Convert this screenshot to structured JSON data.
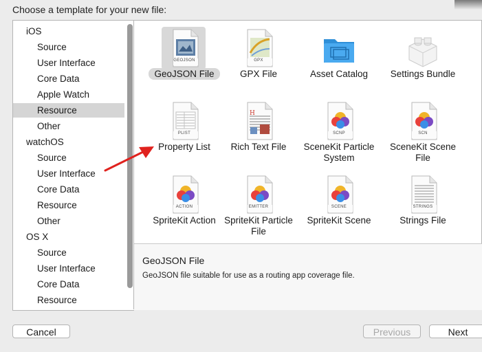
{
  "dialog": {
    "title": "Choose a template for your new file:"
  },
  "sidebar": {
    "items": [
      {
        "label": "iOS",
        "type": "header"
      },
      {
        "label": "Source",
        "type": "sub"
      },
      {
        "label": "User Interface",
        "type": "sub"
      },
      {
        "label": "Core Data",
        "type": "sub"
      },
      {
        "label": "Apple Watch",
        "type": "sub"
      },
      {
        "label": "Resource",
        "type": "sub",
        "selected": true
      },
      {
        "label": "Other",
        "type": "sub"
      },
      {
        "label": "watchOS",
        "type": "header"
      },
      {
        "label": "Source",
        "type": "sub"
      },
      {
        "label": "User Interface",
        "type": "sub"
      },
      {
        "label": "Core Data",
        "type": "sub"
      },
      {
        "label": "Resource",
        "type": "sub"
      },
      {
        "label": "Other",
        "type": "sub"
      },
      {
        "label": "OS X",
        "type": "header"
      },
      {
        "label": "Source",
        "type": "sub"
      },
      {
        "label": "User Interface",
        "type": "sub"
      },
      {
        "label": "Core Data",
        "type": "sub"
      },
      {
        "label": "Resource",
        "type": "sub"
      }
    ]
  },
  "templates": [
    {
      "label": "GeoJSON File",
      "badge": "GEOJSON",
      "icon": "geojson-file-icon",
      "selected": true
    },
    {
      "label": "GPX File",
      "badge": "GPX",
      "icon": "gpx-file-icon"
    },
    {
      "label": "Asset Catalog",
      "badge": "",
      "icon": "folder-icon"
    },
    {
      "label": "Settings Bundle",
      "badge": "",
      "icon": "lego-brick-icon"
    },
    {
      "label": "Property List",
      "badge": "PLIST",
      "icon": "plist-file-icon"
    },
    {
      "label": "Rich Text File",
      "badge": "",
      "icon": "rich-text-file-icon"
    },
    {
      "label": "SceneKit Particle System",
      "badge": "SCNP",
      "icon": "scenekit-particle-icon"
    },
    {
      "label": "SceneKit Scene File",
      "badge": "SCN",
      "icon": "scenekit-scene-icon"
    },
    {
      "label": "SpriteKit Action",
      "badge": "ACTION",
      "icon": "spritekit-action-icon"
    },
    {
      "label": "SpriteKit Particle File",
      "badge": "EMITTER",
      "icon": "spritekit-emitter-icon"
    },
    {
      "label": "SpriteKit Scene",
      "badge": "SCENE",
      "icon": "spritekit-scene-icon"
    },
    {
      "label": "Strings File",
      "badge": "STRINGS",
      "icon": "strings-file-icon"
    }
  ],
  "description": {
    "title": "GeoJSON File",
    "text": "GeoJSON file suitable for use as a routing app coverage file."
  },
  "buttons": {
    "cancel": "Cancel",
    "previous": "Previous",
    "next": "Next"
  },
  "colors": {
    "selection": "#d5d5d5",
    "folder": "#3aa0e8",
    "annotation_arrow": "#e0221e"
  }
}
